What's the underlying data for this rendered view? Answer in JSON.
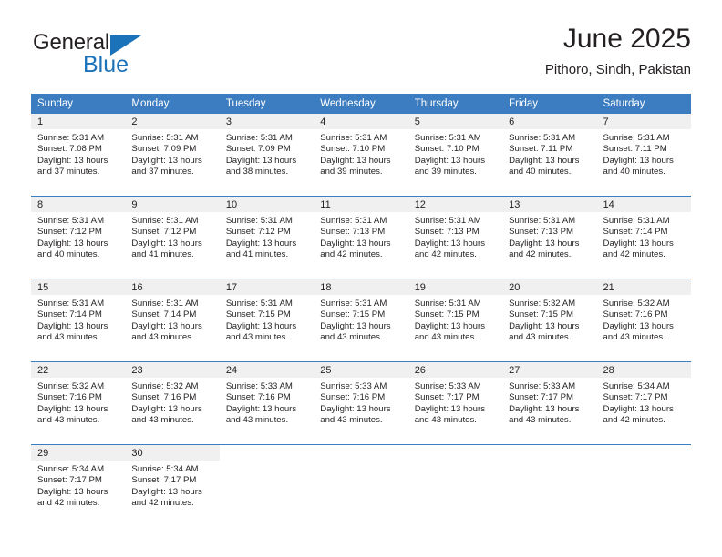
{
  "brand": {
    "name_part1": "General",
    "name_part2": "Blue",
    "accent_color": "#1b72b8"
  },
  "header": {
    "title": "June 2025",
    "subtitle": "Pithoro, Sindh, Pakistan"
  },
  "theme": {
    "header_row_color": "#3b7dc0",
    "day_band_color": "#f0f0f0",
    "text_color": "#231f20"
  },
  "weekdays": [
    "Sunday",
    "Monday",
    "Tuesday",
    "Wednesday",
    "Thursday",
    "Friday",
    "Saturday"
  ],
  "weeks": [
    [
      {
        "day": "1",
        "sunrise": "Sunrise: 5:31 AM",
        "sunset": "Sunset: 7:08 PM",
        "daylight_l1": "Daylight: 13 hours",
        "daylight_l2": "and 37 minutes."
      },
      {
        "day": "2",
        "sunrise": "Sunrise: 5:31 AM",
        "sunset": "Sunset: 7:09 PM",
        "daylight_l1": "Daylight: 13 hours",
        "daylight_l2": "and 37 minutes."
      },
      {
        "day": "3",
        "sunrise": "Sunrise: 5:31 AM",
        "sunset": "Sunset: 7:09 PM",
        "daylight_l1": "Daylight: 13 hours",
        "daylight_l2": "and 38 minutes."
      },
      {
        "day": "4",
        "sunrise": "Sunrise: 5:31 AM",
        "sunset": "Sunset: 7:10 PM",
        "daylight_l1": "Daylight: 13 hours",
        "daylight_l2": "and 39 minutes."
      },
      {
        "day": "5",
        "sunrise": "Sunrise: 5:31 AM",
        "sunset": "Sunset: 7:10 PM",
        "daylight_l1": "Daylight: 13 hours",
        "daylight_l2": "and 39 minutes."
      },
      {
        "day": "6",
        "sunrise": "Sunrise: 5:31 AM",
        "sunset": "Sunset: 7:11 PM",
        "daylight_l1": "Daylight: 13 hours",
        "daylight_l2": "and 40 minutes."
      },
      {
        "day": "7",
        "sunrise": "Sunrise: 5:31 AM",
        "sunset": "Sunset: 7:11 PM",
        "daylight_l1": "Daylight: 13 hours",
        "daylight_l2": "and 40 minutes."
      }
    ],
    [
      {
        "day": "8",
        "sunrise": "Sunrise: 5:31 AM",
        "sunset": "Sunset: 7:12 PM",
        "daylight_l1": "Daylight: 13 hours",
        "daylight_l2": "and 40 minutes."
      },
      {
        "day": "9",
        "sunrise": "Sunrise: 5:31 AM",
        "sunset": "Sunset: 7:12 PM",
        "daylight_l1": "Daylight: 13 hours",
        "daylight_l2": "and 41 minutes."
      },
      {
        "day": "10",
        "sunrise": "Sunrise: 5:31 AM",
        "sunset": "Sunset: 7:12 PM",
        "daylight_l1": "Daylight: 13 hours",
        "daylight_l2": "and 41 minutes."
      },
      {
        "day": "11",
        "sunrise": "Sunrise: 5:31 AM",
        "sunset": "Sunset: 7:13 PM",
        "daylight_l1": "Daylight: 13 hours",
        "daylight_l2": "and 42 minutes."
      },
      {
        "day": "12",
        "sunrise": "Sunrise: 5:31 AM",
        "sunset": "Sunset: 7:13 PM",
        "daylight_l1": "Daylight: 13 hours",
        "daylight_l2": "and 42 minutes."
      },
      {
        "day": "13",
        "sunrise": "Sunrise: 5:31 AM",
        "sunset": "Sunset: 7:13 PM",
        "daylight_l1": "Daylight: 13 hours",
        "daylight_l2": "and 42 minutes."
      },
      {
        "day": "14",
        "sunrise": "Sunrise: 5:31 AM",
        "sunset": "Sunset: 7:14 PM",
        "daylight_l1": "Daylight: 13 hours",
        "daylight_l2": "and 42 minutes."
      }
    ],
    [
      {
        "day": "15",
        "sunrise": "Sunrise: 5:31 AM",
        "sunset": "Sunset: 7:14 PM",
        "daylight_l1": "Daylight: 13 hours",
        "daylight_l2": "and 43 minutes."
      },
      {
        "day": "16",
        "sunrise": "Sunrise: 5:31 AM",
        "sunset": "Sunset: 7:14 PM",
        "daylight_l1": "Daylight: 13 hours",
        "daylight_l2": "and 43 minutes."
      },
      {
        "day": "17",
        "sunrise": "Sunrise: 5:31 AM",
        "sunset": "Sunset: 7:15 PM",
        "daylight_l1": "Daylight: 13 hours",
        "daylight_l2": "and 43 minutes."
      },
      {
        "day": "18",
        "sunrise": "Sunrise: 5:31 AM",
        "sunset": "Sunset: 7:15 PM",
        "daylight_l1": "Daylight: 13 hours",
        "daylight_l2": "and 43 minutes."
      },
      {
        "day": "19",
        "sunrise": "Sunrise: 5:31 AM",
        "sunset": "Sunset: 7:15 PM",
        "daylight_l1": "Daylight: 13 hours",
        "daylight_l2": "and 43 minutes."
      },
      {
        "day": "20",
        "sunrise": "Sunrise: 5:32 AM",
        "sunset": "Sunset: 7:15 PM",
        "daylight_l1": "Daylight: 13 hours",
        "daylight_l2": "and 43 minutes."
      },
      {
        "day": "21",
        "sunrise": "Sunrise: 5:32 AM",
        "sunset": "Sunset: 7:16 PM",
        "daylight_l1": "Daylight: 13 hours",
        "daylight_l2": "and 43 minutes."
      }
    ],
    [
      {
        "day": "22",
        "sunrise": "Sunrise: 5:32 AM",
        "sunset": "Sunset: 7:16 PM",
        "daylight_l1": "Daylight: 13 hours",
        "daylight_l2": "and 43 minutes."
      },
      {
        "day": "23",
        "sunrise": "Sunrise: 5:32 AM",
        "sunset": "Sunset: 7:16 PM",
        "daylight_l1": "Daylight: 13 hours",
        "daylight_l2": "and 43 minutes."
      },
      {
        "day": "24",
        "sunrise": "Sunrise: 5:33 AM",
        "sunset": "Sunset: 7:16 PM",
        "daylight_l1": "Daylight: 13 hours",
        "daylight_l2": "and 43 minutes."
      },
      {
        "day": "25",
        "sunrise": "Sunrise: 5:33 AM",
        "sunset": "Sunset: 7:16 PM",
        "daylight_l1": "Daylight: 13 hours",
        "daylight_l2": "and 43 minutes."
      },
      {
        "day": "26",
        "sunrise": "Sunrise: 5:33 AM",
        "sunset": "Sunset: 7:17 PM",
        "daylight_l1": "Daylight: 13 hours",
        "daylight_l2": "and 43 minutes."
      },
      {
        "day": "27",
        "sunrise": "Sunrise: 5:33 AM",
        "sunset": "Sunset: 7:17 PM",
        "daylight_l1": "Daylight: 13 hours",
        "daylight_l2": "and 43 minutes."
      },
      {
        "day": "28",
        "sunrise": "Sunrise: 5:34 AM",
        "sunset": "Sunset: 7:17 PM",
        "daylight_l1": "Daylight: 13 hours",
        "daylight_l2": "and 42 minutes."
      }
    ],
    [
      {
        "day": "29",
        "sunrise": "Sunrise: 5:34 AM",
        "sunset": "Sunset: 7:17 PM",
        "daylight_l1": "Daylight: 13 hours",
        "daylight_l2": "and 42 minutes."
      },
      {
        "day": "30",
        "sunrise": "Sunrise: 5:34 AM",
        "sunset": "Sunset: 7:17 PM",
        "daylight_l1": "Daylight: 13 hours",
        "daylight_l2": "and 42 minutes."
      },
      {
        "day": "",
        "sunrise": "",
        "sunset": "",
        "daylight_l1": "",
        "daylight_l2": ""
      },
      {
        "day": "",
        "sunrise": "",
        "sunset": "",
        "daylight_l1": "",
        "daylight_l2": ""
      },
      {
        "day": "",
        "sunrise": "",
        "sunset": "",
        "daylight_l1": "",
        "daylight_l2": ""
      },
      {
        "day": "",
        "sunrise": "",
        "sunset": "",
        "daylight_l1": "",
        "daylight_l2": ""
      },
      {
        "day": "",
        "sunrise": "",
        "sunset": "",
        "daylight_l1": "",
        "daylight_l2": ""
      }
    ]
  ]
}
